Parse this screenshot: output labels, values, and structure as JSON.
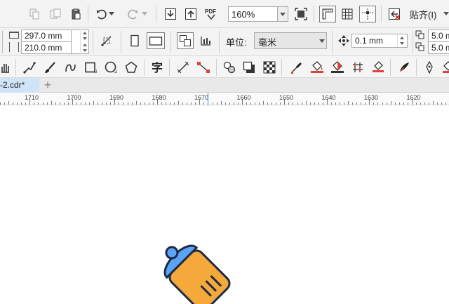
{
  "document": {
    "tab_label": "-2.cdr*",
    "new_tab_label": "+"
  },
  "toolbar": {
    "zoom_value": "160%",
    "snap_label": "贴齐(I)"
  },
  "property_bar": {
    "page_width": "297.0 mm",
    "page_height": "210.0 mm",
    "units_label": "单位:",
    "units_value": "毫米",
    "nudge_value": "0.1 mm",
    "dup_x": "5.0 m",
    "dup_y": "5.0 m"
  },
  "ruler": {
    "labels": [
      "1710",
      "1700",
      "1690",
      "1680",
      "1670",
      "1660",
      "1650",
      "1640",
      "1630",
      "1620"
    ]
  },
  "colors": {
    "bottle_body": "#F5A93B",
    "bottle_cap": "#5BA3F5",
    "outline": "#1F2A44",
    "active_tab": "#cfe5f7",
    "ruler_marker": "#3a8ee6"
  }
}
